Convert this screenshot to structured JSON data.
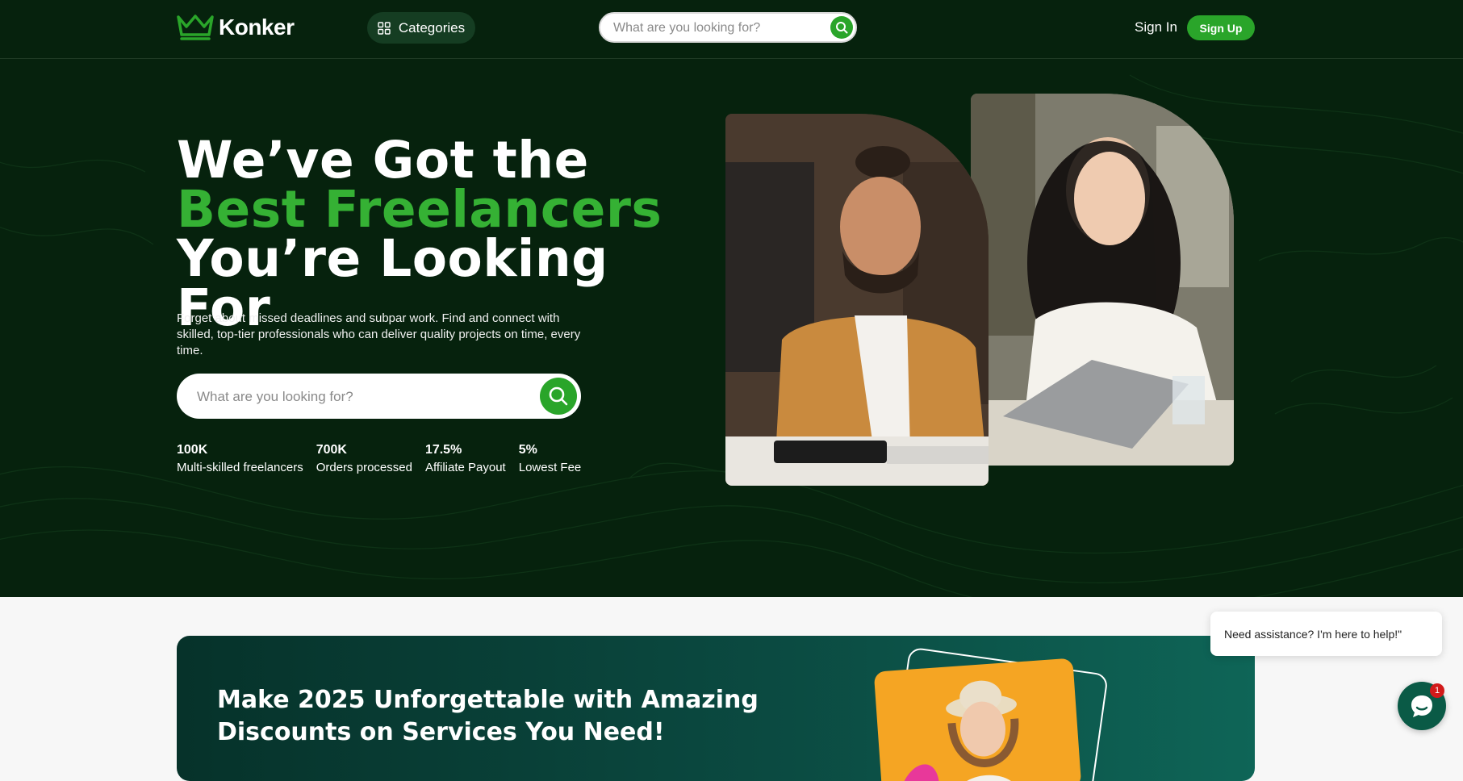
{
  "header": {
    "logo_text": "Konker",
    "categories_label": "Categories",
    "search_placeholder": "What are you looking for?",
    "signin_label": "Sign In",
    "signup_label": "Sign Up"
  },
  "hero": {
    "headline_part1": "We’ve Got the ",
    "headline_accent": "Best Freelancers",
    "headline_part2": " You’re Looking For",
    "subtext": "Forget about missed deadlines and subpar work. Find and connect with skilled, top-tier professionals who can deliver quality projects on time, every time.",
    "search_placeholder": "What are you looking for?",
    "stats": [
      {
        "num": "100K",
        "label": "Multi-skilled freelancers"
      },
      {
        "num": "700K",
        "label": "Orders processed"
      },
      {
        "num": "17.5%",
        "label": "Affiliate Payout"
      },
      {
        "num": "5%",
        "label": "Lowest Fee"
      }
    ]
  },
  "promo": {
    "title": "Make 2025 Unforgettable with Amazing Discounts on Services You Need!"
  },
  "chat": {
    "message": "Need assistance? I'm here to help!\"",
    "badge_count": "1"
  },
  "colors": {
    "brand_green": "#2aa52a",
    "accent_text_green": "#35b134",
    "hero_bg": "#06220d",
    "promo_bg": "#0b4a41"
  }
}
